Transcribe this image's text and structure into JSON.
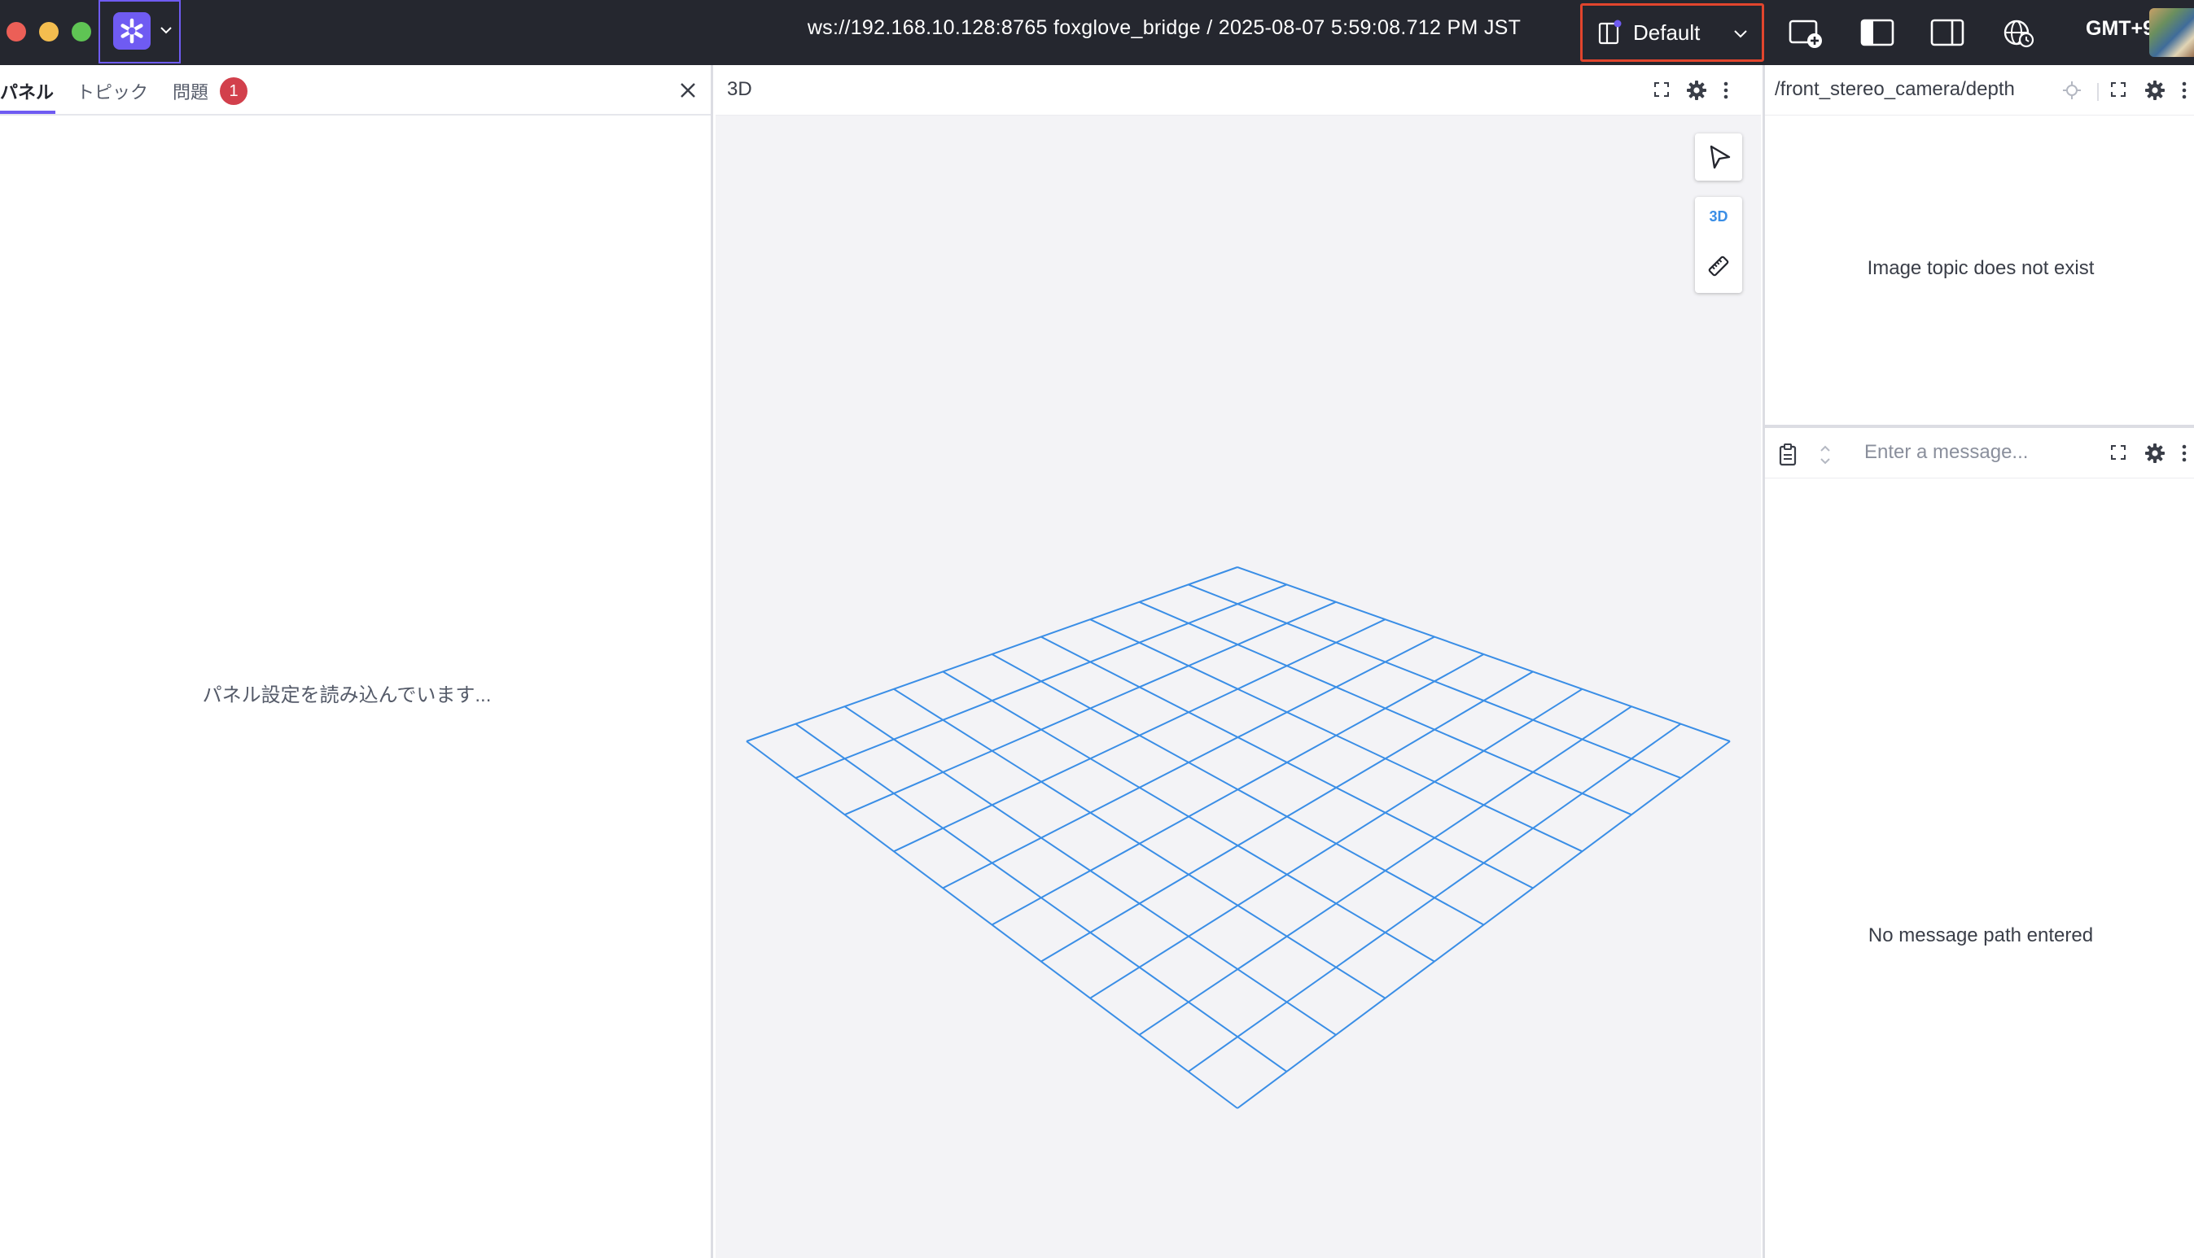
{
  "appbar": {
    "connection_title": "ws://192.168.10.128:8765 foxglove_bridge / 2025-08-07 5:59:08.712 PM JST",
    "layout_label": "Default",
    "timezone_label": "GMT+9",
    "accent_color": "#6f5bf2"
  },
  "sidebar": {
    "tabs": [
      {
        "label": "パネル"
      },
      {
        "label": "トピック"
      },
      {
        "label": "問題"
      }
    ],
    "issues_count": "1",
    "loading_text": "パネル設定を読み込んでいます..."
  },
  "panel_3d": {
    "title": "3D",
    "mode_label": "3D",
    "grid_color": "#3a8ee6"
  },
  "image_panel": {
    "title": "/front_stereo_camera/depth",
    "empty_message": "Image topic does not exist"
  },
  "plot_panel": {
    "input_placeholder": "Enter a message...",
    "empty_message": "No message path entered"
  }
}
